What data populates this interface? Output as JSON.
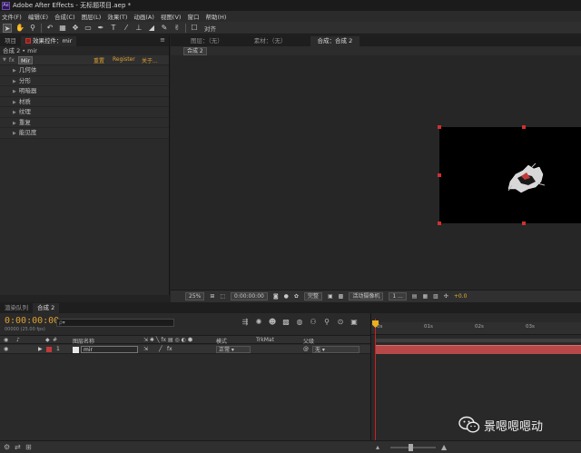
{
  "window": {
    "title": "Adobe After Effects - 无标题项目.aep *",
    "logo": "Ae"
  },
  "menu": [
    "文件(F)",
    "编辑(E)",
    "合成(C)",
    "图层(L)",
    "效果(T)",
    "动画(A)",
    "视图(V)",
    "窗口",
    "帮助(H)"
  ],
  "toolbar": {
    "align_label": "对齐"
  },
  "left_panel": {
    "tabs": [
      "项目",
      "效果控件：mir"
    ],
    "menu_icon": "≡",
    "subtitle": "合成 2 • mir",
    "fx_label": "fx",
    "effect_name": "Mir",
    "links": [
      "重置",
      "Register",
      "关于..."
    ],
    "properties": [
      "几何体",
      "分形",
      "明暗器",
      "材质",
      "纹理",
      "重复",
      "能见度"
    ]
  },
  "viewer": {
    "tabs": [
      "图层：（无）",
      "素材：（无）",
      "合成：合成 2"
    ],
    "comp_chip": "合成 2",
    "zoom": "25%",
    "timecode": "0:00:00:00",
    "quality": "完整",
    "camera": "活动摄像机",
    "views": "1 ...",
    "exposure": "+0.0"
  },
  "timeline": {
    "tabs": [
      "渲染队列",
      "合成 2"
    ],
    "timecode": "0:00:00:00",
    "fps": "00000 (25.00 fps)",
    "search_placeholder": "ρ▾",
    "columns": {
      "layer_name": "图层名称",
      "mode": "模式",
      "trkmat": "TrkMat",
      "parent": "父级"
    },
    "layer": {
      "index": "1",
      "name": "mir",
      "mode": "正常",
      "parent": "无",
      "fx": "fx"
    },
    "ruler": [
      "0s",
      "01s",
      "02s",
      "03s"
    ]
  },
  "watermark": {
    "text": "景嗯嗯嗯动"
  },
  "colors": {
    "accent": "#e0a030",
    "layer_bar": "#b84848",
    "playhead": "#d02020"
  }
}
